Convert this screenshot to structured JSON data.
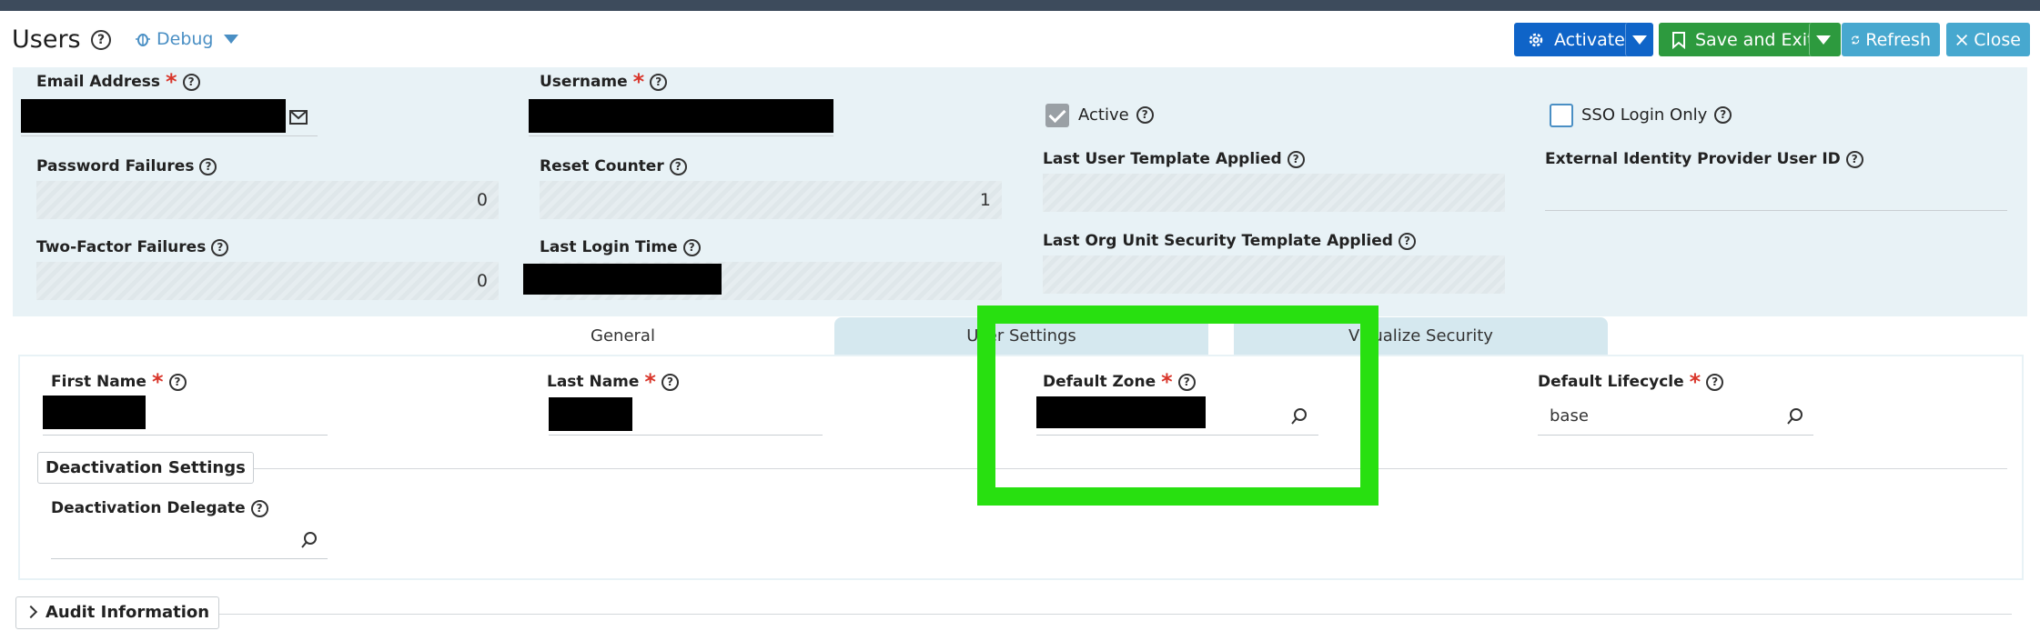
{
  "header": {
    "title": "Users",
    "debug_label": "Debug",
    "buttons": {
      "activate": "Activate",
      "save_and_exit": "Save and Exit",
      "refresh": "Refresh",
      "close": "Close"
    }
  },
  "user_header": {
    "email_address": {
      "label": "Email Address",
      "value": ""
    },
    "username": {
      "label": "Username",
      "value": ""
    },
    "active": {
      "label": "Active",
      "checked": true
    },
    "sso_login_only": {
      "label": "SSO Login Only",
      "checked": false
    },
    "password_failures": {
      "label": "Password Failures",
      "value": "0"
    },
    "reset_counter": {
      "label": "Reset Counter",
      "value": "1"
    },
    "last_user_template_applied": {
      "label": "Last User Template Applied",
      "value": ""
    },
    "external_identity_provider_user_id": {
      "label": "External Identity Provider User ID",
      "value": ""
    },
    "two_factor_failures": {
      "label": "Two-Factor Failures",
      "value": "0"
    },
    "last_login_time": {
      "label": "Last Login Time",
      "value": ""
    },
    "last_org_unit_security_template_applied": {
      "label": "Last Org Unit Security Template Applied",
      "value": ""
    }
  },
  "tabs": [
    {
      "label": "General",
      "active": true
    },
    {
      "label": "User Settings",
      "active": false
    },
    {
      "label": "Visualize Security",
      "active": false
    }
  ],
  "general": {
    "first_name": {
      "label": "First Name",
      "value": ""
    },
    "last_name": {
      "label": "Last Name",
      "value": ""
    },
    "default_zone": {
      "label": "Default Zone",
      "value": ""
    },
    "default_lifecycle": {
      "label": "Default Lifecycle",
      "value": "base"
    },
    "deactivation_settings": "Deactivation Settings",
    "deactivation_delegate": {
      "label": "Deactivation Delegate",
      "value": ""
    }
  },
  "audit_information": "Audit Information",
  "colors": {
    "activate": "#0f64c8",
    "save": "#2d9a3e",
    "refresh": "#47a8cf",
    "highlight": "#28e010",
    "required": "#d9362b"
  }
}
